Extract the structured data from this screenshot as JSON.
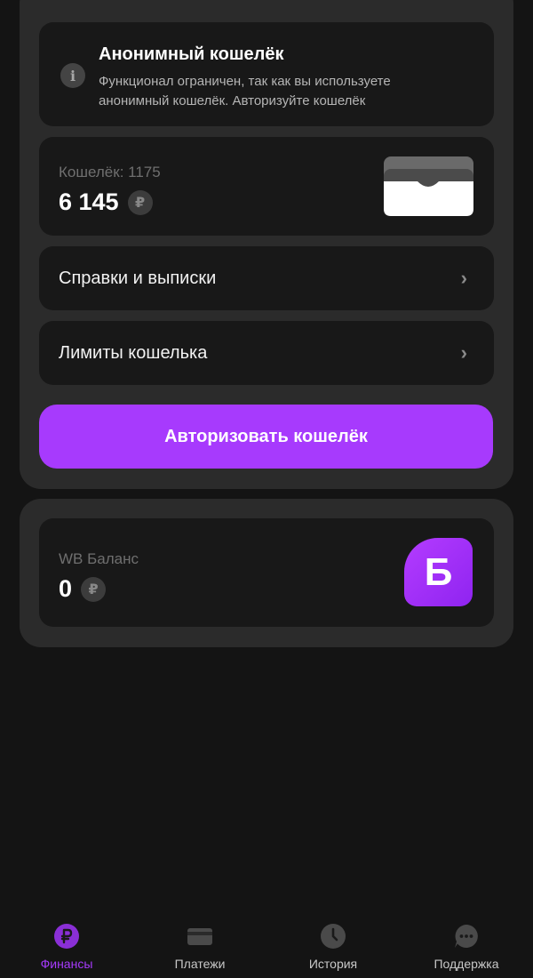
{
  "notice": {
    "title": "Анонимный кошелёк",
    "text": "Функционал ограничен, так как вы используете анонимный кошелёк. Авторизуйте кошелёк",
    "icon": "info-icon"
  },
  "wallet": {
    "label": "Кошелёк: 1175",
    "amount": "6 145",
    "currency": "₽"
  },
  "menu": [
    {
      "label": "Справки и выписки",
      "chevron": "›"
    },
    {
      "label": "Лимиты кошелька",
      "chevron": "›"
    }
  ],
  "authorize_button": {
    "label": "Авторизовать кошелёк",
    "color": "#a73afd"
  },
  "wb_balance": {
    "label": "WB Баланс",
    "amount": "0",
    "currency": "₽",
    "logo_letter": "Б"
  },
  "bottom_nav": {
    "items": [
      {
        "label": "Финансы",
        "icon": "ruble-icon",
        "active": true
      },
      {
        "label": "Платежи",
        "icon": "card-icon",
        "active": false
      },
      {
        "label": "История",
        "icon": "clock-icon",
        "active": false
      },
      {
        "label": "Поддержка",
        "icon": "chat-icon",
        "active": false
      }
    ]
  },
  "colors": {
    "accent": "#a73afd",
    "background": "#141414",
    "card": "#181818",
    "group": "#2b2b2b"
  }
}
